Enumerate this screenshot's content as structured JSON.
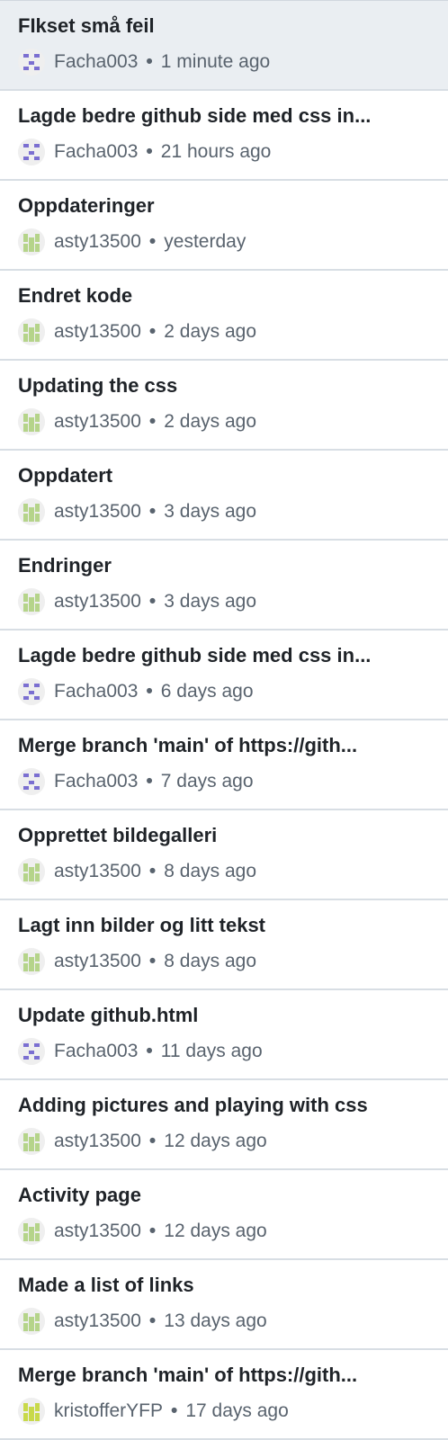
{
  "commits": [
    {
      "title": "FIkset små feil",
      "author": "Facha003",
      "separator": "•",
      "time": "1 minute ago",
      "avatar_color": "#7b6fd1",
      "avatar_icon": "identicon-avatar",
      "selected": true
    },
    {
      "title": "Lagde bedre github side med css in...",
      "author": "Facha003",
      "separator": "•",
      "time": "21 hours ago",
      "avatar_color": "#7b6fd1",
      "avatar_icon": "identicon-avatar"
    },
    {
      "title": "Oppdateringer",
      "author": "asty13500",
      "separator": "•",
      "time": "yesterday",
      "avatar_color": "#b5d48a",
      "avatar_icon": "identicon-avatar"
    },
    {
      "title": "Endret kode",
      "author": "asty13500",
      "separator": "•",
      "time": "2 days ago",
      "avatar_color": "#b5d48a",
      "avatar_icon": "identicon-avatar"
    },
    {
      "title": "Updating the css",
      "author": "asty13500",
      "separator": "•",
      "time": "2 days ago",
      "avatar_color": "#b5d48a",
      "avatar_icon": "identicon-avatar"
    },
    {
      "title": "Oppdatert",
      "author": "asty13500",
      "separator": "•",
      "time": "3 days ago",
      "avatar_color": "#b5d48a",
      "avatar_icon": "identicon-avatar"
    },
    {
      "title": "Endringer",
      "author": "asty13500",
      "separator": "•",
      "time": "3 days ago",
      "avatar_color": "#b5d48a",
      "avatar_icon": "identicon-avatar"
    },
    {
      "title": "Lagde bedre github side med css in...",
      "author": "Facha003",
      "separator": "•",
      "time": "6 days ago",
      "avatar_color": "#7b6fd1",
      "avatar_icon": "identicon-avatar"
    },
    {
      "title": "Merge branch 'main' of https://gith...",
      "author": "Facha003",
      "separator": "•",
      "time": "7 days ago",
      "avatar_color": "#7b6fd1",
      "avatar_icon": "identicon-avatar"
    },
    {
      "title": "Opprettet bildegalleri",
      "author": "asty13500",
      "separator": "•",
      "time": "8 days ago",
      "avatar_color": "#b5d48a",
      "avatar_icon": "identicon-avatar"
    },
    {
      "title": "Lagt inn bilder og litt tekst",
      "author": "asty13500",
      "separator": "•",
      "time": "8 days ago",
      "avatar_color": "#b5d48a",
      "avatar_icon": "identicon-avatar"
    },
    {
      "title": "Update github.html",
      "author": "Facha003",
      "separator": "•",
      "time": "11 days ago",
      "avatar_color": "#7b6fd1",
      "avatar_icon": "identicon-avatar"
    },
    {
      "title": "Adding pictures and playing with css",
      "author": "asty13500",
      "separator": "•",
      "time": "12 days ago",
      "avatar_color": "#b5d48a",
      "avatar_icon": "identicon-avatar"
    },
    {
      "title": "Activity page",
      "author": "asty13500",
      "separator": "•",
      "time": "12 days ago",
      "avatar_color": "#b5d48a",
      "avatar_icon": "identicon-avatar"
    },
    {
      "title": "Made a list of links",
      "author": "asty13500",
      "separator": "•",
      "time": "13 days ago",
      "avatar_color": "#b5d48a",
      "avatar_icon": "identicon-avatar"
    },
    {
      "title": "Merge branch 'main' of https://gith...",
      "author": "kristofferYFP",
      "separator": "•",
      "time": "17 days ago",
      "avatar_color": "#c8d94a",
      "avatar_icon": "identicon-avatar"
    }
  ]
}
